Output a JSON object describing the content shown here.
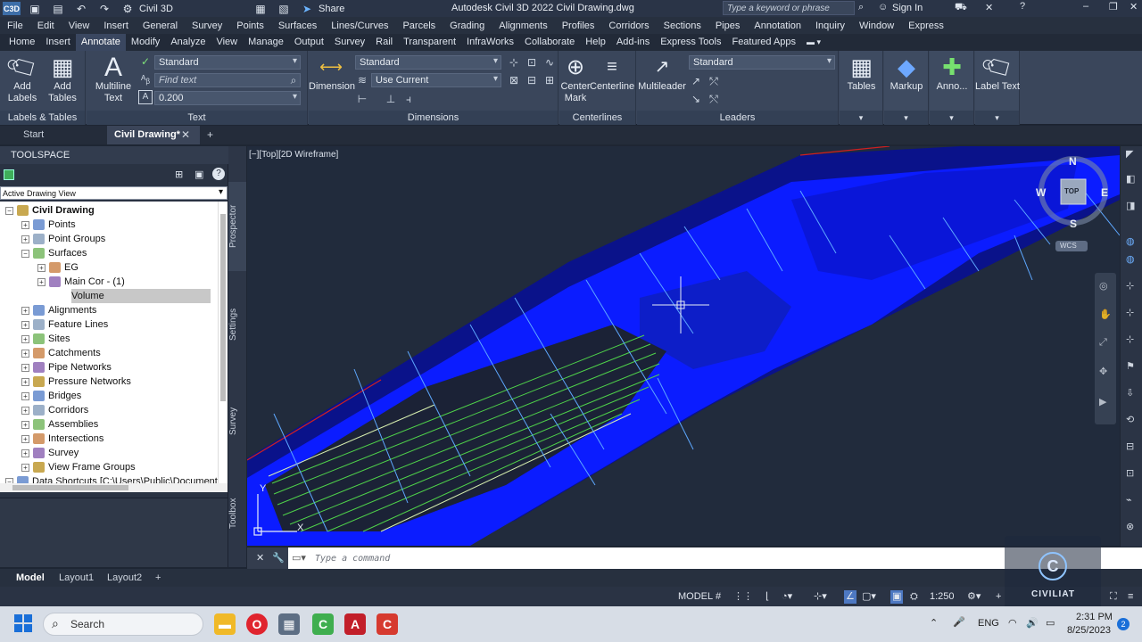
{
  "titlebar": {
    "app_short": "Civil 3D",
    "share": "Share",
    "title": "Autodesk Civil 3D 2022    Civil Drawing.dwg",
    "search_placeholder": "Type a keyword or phrase",
    "sign_in": "Sign In"
  },
  "menu": [
    "File",
    "Edit",
    "View",
    "Insert",
    "General",
    "Survey",
    "Points",
    "Surfaces",
    "Lines/Curves",
    "Parcels",
    "Grading",
    "Alignments",
    "Profiles",
    "Corridors",
    "Sections",
    "Pipes",
    "Annotation",
    "Inquiry",
    "Window",
    "Express"
  ],
  "ribbon_tabs": [
    "Home",
    "Insert",
    "Annotate",
    "Modify",
    "Analyze",
    "View",
    "Manage",
    "Output",
    "Survey",
    "Rail",
    "Transparent",
    "InfraWorks",
    "Collaborate",
    "Help",
    "Add-ins",
    "Express Tools",
    "Featured Apps"
  ],
  "ribbon_active_tab": "Annotate",
  "ribbon": {
    "add_labels": "Add Labels",
    "add_tables": "Add Tables",
    "labels_tables": "Labels & Tables",
    "multiline_text": "Multiline Text",
    "text_style": "Standard",
    "find_text": "Find text",
    "text_height": "0.200",
    "text_panel": "Text",
    "dimension": "Dimension",
    "dim_style": "Standard",
    "dim_layer": "Use Current",
    "dimensions_panel": "Dimensions",
    "center_mark": "Center Mark",
    "centerline": "Centerline",
    "centerlines_panel": "Centerlines",
    "multileader": "Multileader",
    "leader_style": "Standard",
    "leaders_panel": "Leaders",
    "tables": "Tables",
    "markup": "Markup",
    "anno": "Anno...",
    "label_text": "Label Text"
  },
  "doc_tabs": {
    "start": "Start",
    "active": "Civil Drawing*"
  },
  "toolspace": {
    "header": "TOOLSPACE",
    "view": "Active Drawing View",
    "tree": [
      {
        "label": "Civil Drawing",
        "level": 0,
        "bold": true
      },
      {
        "label": "Points",
        "level": 1
      },
      {
        "label": "Point Groups",
        "level": 1
      },
      {
        "label": "Surfaces",
        "level": 1
      },
      {
        "label": "EG",
        "level": 2
      },
      {
        "label": "Main Cor - (1)",
        "level": 2
      },
      {
        "label": "Volume",
        "level": 2,
        "selected": true
      },
      {
        "label": "Alignments",
        "level": 1
      },
      {
        "label": "Feature Lines",
        "level": 1
      },
      {
        "label": "Sites",
        "level": 1
      },
      {
        "label": "Catchments",
        "level": 1
      },
      {
        "label": "Pipe Networks",
        "level": 1
      },
      {
        "label": "Pressure Networks",
        "level": 1
      },
      {
        "label": "Bridges",
        "level": 1
      },
      {
        "label": "Corridors",
        "level": 1
      },
      {
        "label": "Assemblies",
        "level": 1
      },
      {
        "label": "Intersections",
        "level": 1
      },
      {
        "label": "Survey",
        "level": 1
      },
      {
        "label": "View Frame Groups",
        "level": 1
      },
      {
        "label": "Data Shortcuts [C:\\Users\\Public\\Documents]",
        "level": 0
      }
    ],
    "vtabs": [
      "Prospector",
      "Settings",
      "Survey",
      "Toolbox"
    ]
  },
  "viewport": {
    "label": "[−][Top][2D Wireframe]",
    "compass": {
      "n": "N",
      "s": "S",
      "e": "E",
      "w": "W",
      "top": "TOP",
      "wcs": "WCS"
    },
    "axis_y": "Y",
    "axis_x": "X"
  },
  "command": {
    "placeholder": "Type a command"
  },
  "layout_tabs": [
    "Model",
    "Layout1",
    "Layout2"
  ],
  "status": {
    "model": "MODEL",
    "scale": "1:250"
  },
  "taskbar": {
    "search": "Search",
    "lang": "ENG",
    "time": "2:31 PM",
    "date": "8/25/2023",
    "badge": "2"
  },
  "watermark": {
    "brand": "CIVILIAT"
  },
  "colors": {
    "accent": "#3a4760",
    "surface_blue": "#0a1bff",
    "grid_green": "#4fd24a"
  }
}
